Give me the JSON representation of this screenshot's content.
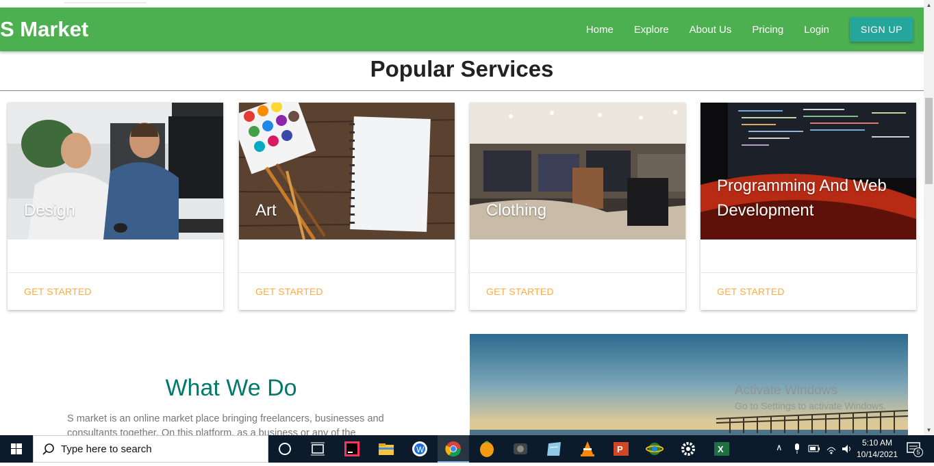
{
  "brand": "S Market",
  "nav": {
    "links": [
      "Home",
      "Explore",
      "About Us",
      "Pricing",
      "Login"
    ],
    "signup_label": "SIGN UP"
  },
  "popular": {
    "title": "Popular Services",
    "cards": [
      {
        "title": "Design",
        "action": "GET STARTED"
      },
      {
        "title": "Art",
        "action": "GET STARTED"
      },
      {
        "title": "Clothing",
        "action": "GET STARTED"
      },
      {
        "title": "Programming And Web Development",
        "action": "GET STARTED"
      }
    ]
  },
  "what_we_do": {
    "title": "What We Do",
    "text": "S market is an online market place bringing freelancers, businesses and consultants together. On this platform, as a business or any of the"
  },
  "watermark": {
    "line1": "Activate Windows",
    "line2": "Go to Settings to activate Windows."
  },
  "taskbar": {
    "search_placeholder": "Type here to search",
    "time": "5:10 AM",
    "date": "10/14/2021",
    "notification_count": "5"
  },
  "colors": {
    "navbar": "#4caf50",
    "signup": "#26a69a",
    "accent_orange": "#ffab40",
    "teal_title": "#00796b"
  }
}
